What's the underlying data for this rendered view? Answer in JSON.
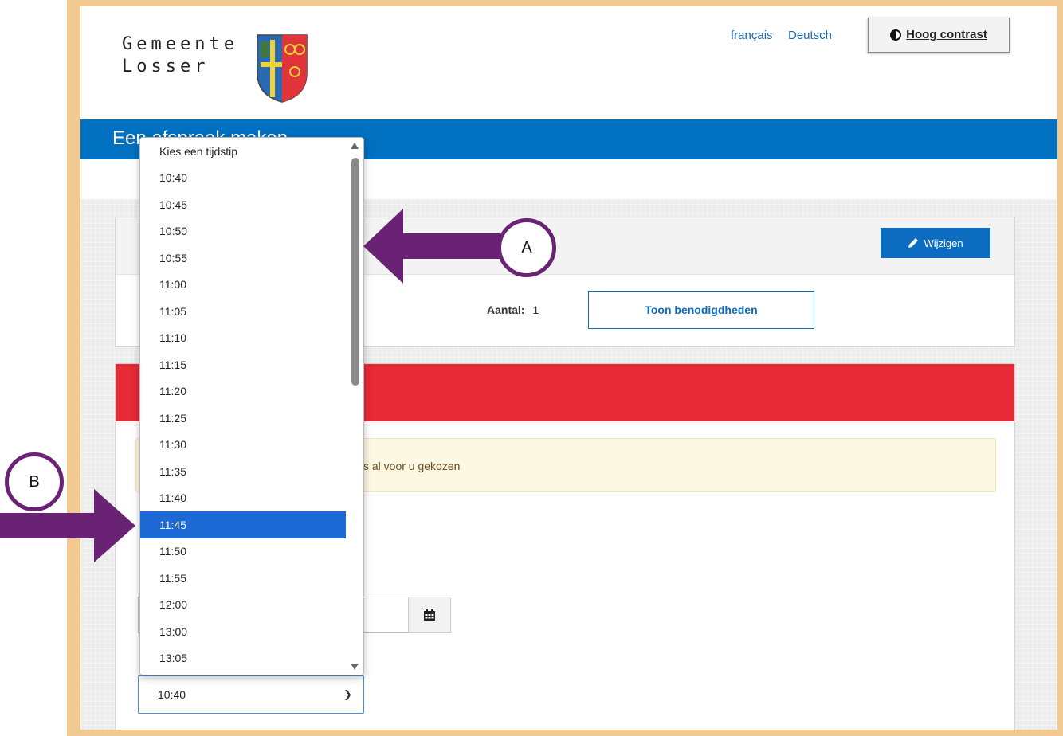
{
  "header": {
    "logo_line1": "Gemeente",
    "logo_line2": "Losser",
    "lang_fr": "français",
    "lang_de": "Deutsch",
    "contrast_label": "Hoog contrast"
  },
  "page": {
    "title": "Een afspraak maken"
  },
  "panel": {
    "edit_label": "Wijzigen",
    "aantal_label": "Aantal:",
    "aantal_value": "1",
    "toon_label": "Toon benodigdheden"
  },
  "notice": {
    "text": "s al voor u gekozen"
  },
  "time_select": {
    "value": "10:40",
    "options": [
      "Kies een tijdstip",
      "10:40",
      "10:45",
      "10:50",
      "10:55",
      "11:00",
      "11:05",
      "11:10",
      "11:15",
      "11:20",
      "11:25",
      "11:30",
      "11:35",
      "11:40",
      "11:45",
      "11:50",
      "11:55",
      "12:00",
      "13:00",
      "13:05"
    ],
    "highlighted": "11:45"
  },
  "annotations": {
    "a": "A",
    "b": "B"
  },
  "colors": {
    "frame": "#f3c992",
    "title_bar": "#0070c0",
    "red_bar": "#e62a36",
    "highlight": "#1d6ad6",
    "arrow": "#6a2374",
    "button_blue": "#0b6cc0"
  }
}
